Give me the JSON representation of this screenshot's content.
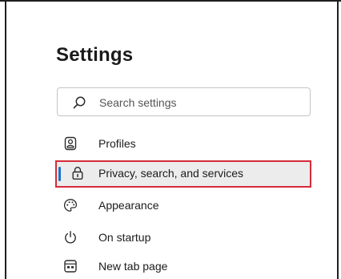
{
  "page": {
    "title": "Settings"
  },
  "search": {
    "placeholder": "Search settings",
    "icon": "search-icon"
  },
  "nav": {
    "items": [
      {
        "label": "Profiles",
        "icon": "profile-icon",
        "selected": false
      },
      {
        "label": "Privacy, search, and services",
        "icon": "lock-icon",
        "selected": true
      },
      {
        "label": "Appearance",
        "icon": "palette-icon",
        "selected": false
      },
      {
        "label": "On startup",
        "icon": "power-icon",
        "selected": false
      },
      {
        "label": "New tab page",
        "icon": "new-tab-page-icon",
        "selected": false
      }
    ]
  },
  "colors": {
    "selected_outline": "#d52b3a",
    "selected_accent": "#1a73c8",
    "selected_background": "#ececec"
  }
}
